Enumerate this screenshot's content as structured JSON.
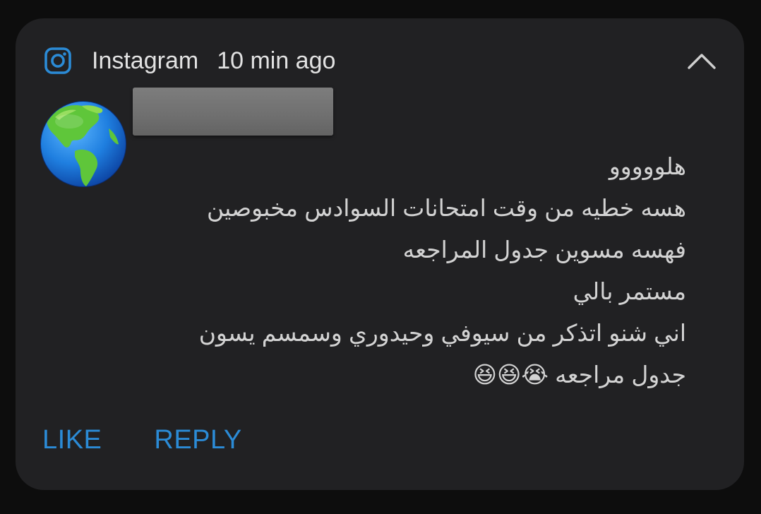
{
  "notification": {
    "app_name": "Instagram",
    "time_ago": "10 min ago",
    "app_icon": "instagram-icon",
    "collapse_icon": "chevron-up-icon",
    "accent_color": "#2b8bd6",
    "avatar_icon": "globe-americas-icon",
    "sender_name": "",
    "message_lines": [
      "هلووووو",
      "هسه خطيه من وقت امتحانات السوادس مخبوصين",
      "فهسه مسوين جدول المراجعه",
      "مستمر بالي",
      "اني شنو اتذكر من سيوفي وحيدوري وسمسم يسون",
      "جدول مراجعه 😭😆😆"
    ],
    "actions": {
      "like_label": "LIKE",
      "reply_label": "REPLY"
    }
  }
}
